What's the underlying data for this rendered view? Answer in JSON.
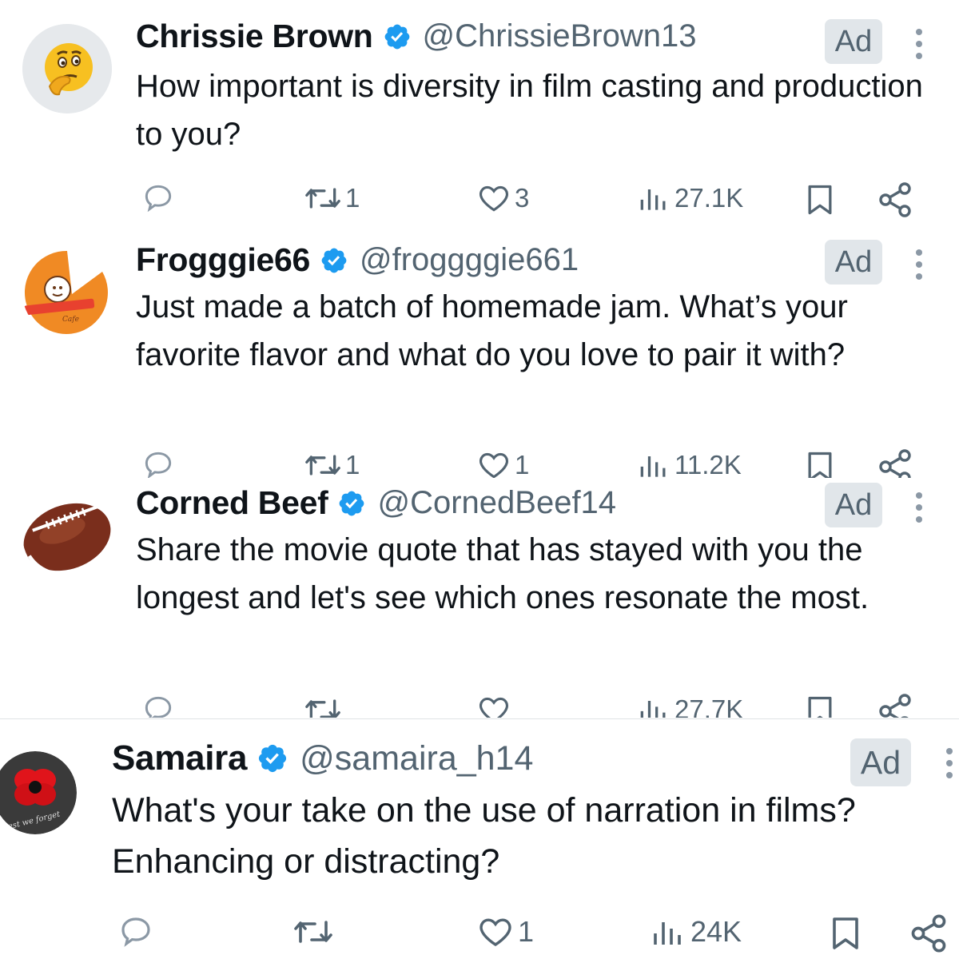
{
  "tweets": [
    {
      "name": "Chrissie Brown",
      "handle": "@ChrissieBrown13",
      "ad_label": "Ad",
      "text": "How important is diversity in film casting and production to you?",
      "avatar_icon": "thinking-face-emoji",
      "stats": {
        "replies": "",
        "retweets": "1",
        "likes": "3",
        "views": "27.1K"
      }
    },
    {
      "name": "Frogggie66",
      "handle": "@froggggie661",
      "ad_label": "Ad",
      "text": "Just made a batch of homemade jam. What’s your favorite flavor and what do you love to pair it with?",
      "avatar_icon": "cafe-logo",
      "stats": {
        "replies": "",
        "retweets": "1",
        "likes": "1",
        "views": "11.2K"
      }
    },
    {
      "name": "Corned Beef",
      "handle": "@CornedBeef14",
      "ad_label": "Ad",
      "text": "Share the movie quote that has stayed with you the longest and let's see which ones resonate the most.",
      "avatar_icon": "football",
      "stats": {
        "replies": "",
        "retweets": "",
        "likes": "",
        "views": "27.7K"
      }
    },
    {
      "name": "Samaira",
      "handle": "@samaira_h14",
      "ad_label": "Ad",
      "text": "What's your take on the use of narration in films? Enhancing or distracting?",
      "avatar_icon": "red-poppy",
      "stats": {
        "replies": "",
        "retweets": "",
        "likes": "1",
        "views": "24K"
      }
    }
  ],
  "colors": {
    "verified": "#1d9bf0",
    "muted": "#536471",
    "ad_bg": "#e1e6ea"
  }
}
